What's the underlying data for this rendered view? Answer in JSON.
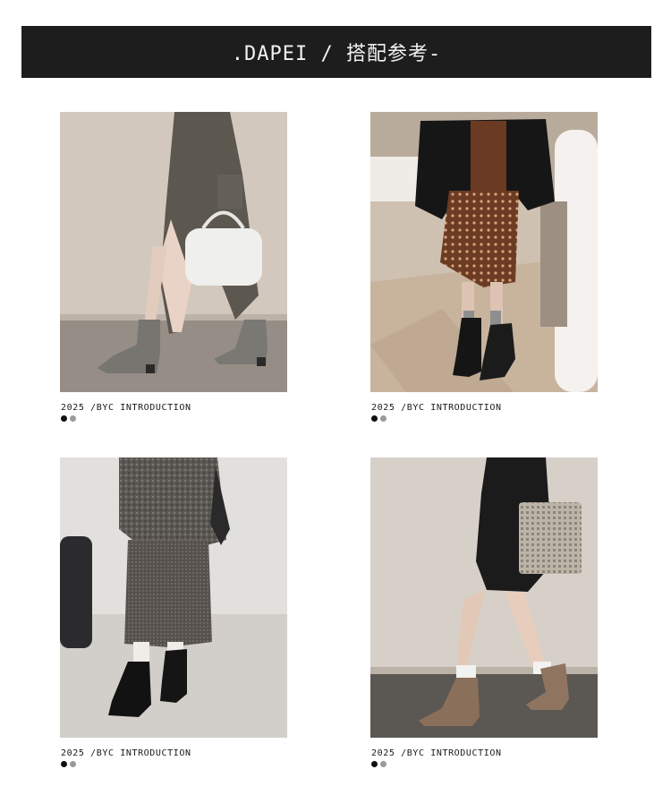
{
  "header": {
    "title": ".DAPEI / 搭配参考-"
  },
  "cards": [
    {
      "caption": "2025 /BYC INTRODUCTION"
    },
    {
      "caption": "2025 /BYC INTRODUCTION"
    },
    {
      "caption": "2025 /BYC INTRODUCTION"
    },
    {
      "caption": "2025 /BYC INTRODUCTION"
    }
  ],
  "colors": {
    "header_bg": "#1d1d1d",
    "header_text": "#f2f2f2",
    "dot_active": "#111111",
    "dot_inactive": "#9a9a9a"
  }
}
